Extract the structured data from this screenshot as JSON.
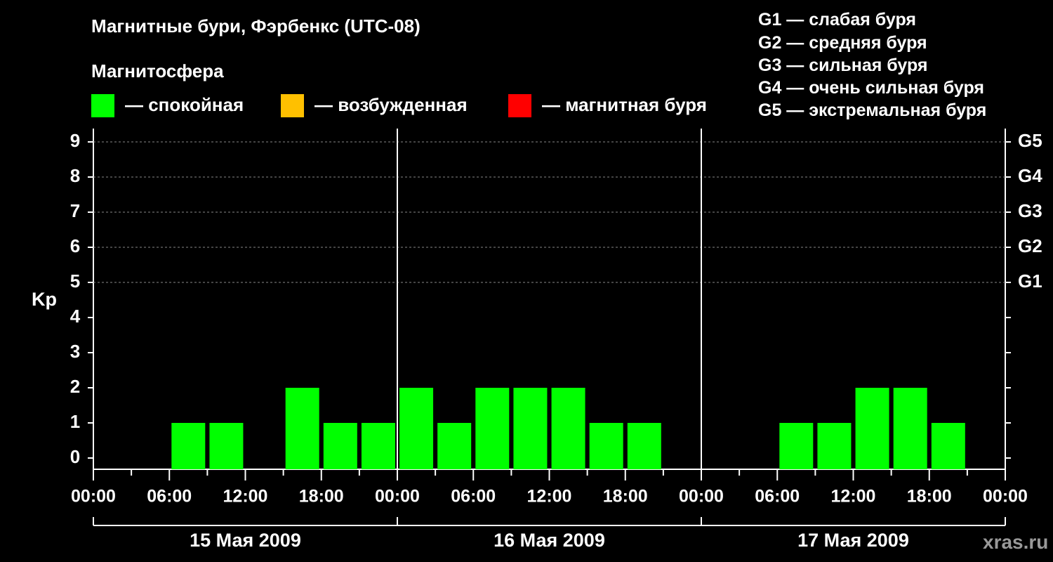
{
  "title": "Магнитные бури, Фэрбенкс (UTC-08)",
  "magnetosphere": {
    "title": "Магнитосфера",
    "legend": [
      {
        "color": "#00ff00",
        "label": "— спокойная"
      },
      {
        "color": "#ffc000",
        "label": "— возбужденная"
      },
      {
        "color": "#ff0000",
        "label": "— магнитная буря"
      }
    ]
  },
  "g_scale": [
    "G1 — слабая буря",
    "G2 — средняя буря",
    "G3 — сильная буря",
    "G4 — очень сильная буря",
    "G5 — экстремальная буря"
  ],
  "watermark": "xras.ru",
  "chart_data": {
    "type": "bar",
    "ylabel": "Kp",
    "ylim": [
      0,
      9
    ],
    "yticks": [
      0,
      1,
      2,
      3,
      4,
      5,
      6,
      7,
      8,
      9
    ],
    "right_axis": [
      {
        "kp": 5,
        "label": "G1"
      },
      {
        "kp": 6,
        "label": "G2"
      },
      {
        "kp": 7,
        "label": "G3"
      },
      {
        "kp": 8,
        "label": "G4"
      },
      {
        "kp": 9,
        "label": "G5"
      }
    ],
    "grid": "dashed horizontal at Kp 5-9",
    "xtick_labels": [
      "00:00",
      "06:00",
      "12:00",
      "18:00",
      "00:00",
      "06:00",
      "12:00",
      "18:00",
      "00:00",
      "06:00",
      "12:00",
      "18:00",
      "00:00"
    ],
    "days": [
      "15 Мая 2009",
      "16 Мая 2009",
      "17 Мая 2009"
    ],
    "intervals_per_day": 8,
    "color_rule": {
      "quiet": "#00ff00",
      "disturbed": "#ffc000",
      "storm": "#ff0000"
    },
    "series": [
      {
        "day": "15 Мая 2009",
        "values": [
          null,
          null,
          1,
          1,
          null,
          2,
          1,
          1
        ]
      },
      {
        "day": "16 Мая 2009",
        "values": [
          2,
          1,
          2,
          2,
          2,
          1,
          1,
          null
        ]
      },
      {
        "day": "17 Мая 2009",
        "values": [
          null,
          null,
          1,
          1,
          2,
          2,
          1,
          null
        ]
      }
    ]
  }
}
